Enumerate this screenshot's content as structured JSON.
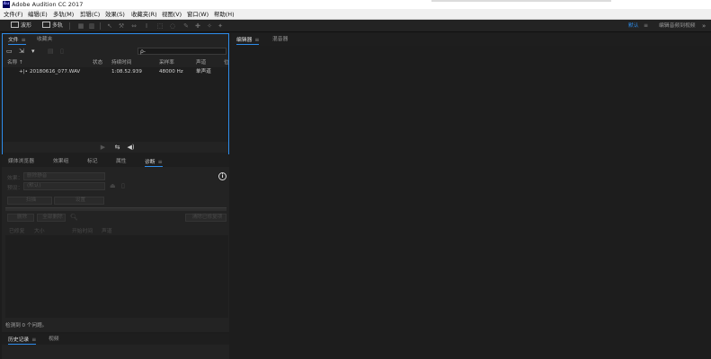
{
  "window": {
    "title": "Adobe Audition CC 2017",
    "logo": "Au"
  },
  "menu": [
    "文件(F)",
    "编辑(E)",
    "多轨(M)",
    "剪辑(C)",
    "效果(S)",
    "收藏夹(R)",
    "视图(V)",
    "窗口(W)",
    "帮助(H)"
  ],
  "toolbar": {
    "waveform_label": "波形",
    "multitrack_label": "多轨",
    "workspace_default": "默认",
    "workspace_edit": "编辑音频到视频",
    "more": "»"
  },
  "files_panel": {
    "tabs": [
      "文件",
      "收藏夹"
    ],
    "search_placeholder": "ρ-",
    "columns": {
      "name": "名称 ↑",
      "status": "状态",
      "duration": "持续时间",
      "sample_rate": "采样率",
      "channels": "声道",
      "bit": "位"
    },
    "rows": [
      {
        "name": "20180616_077.WAV",
        "duration": "1:08.52.939",
        "sample_rate": "48000 Hz",
        "channels": "单声道"
      }
    ]
  },
  "effects_panel": {
    "tabs": [
      "媒体浏览器",
      "效果组",
      "标记",
      "属性",
      "诊断"
    ],
    "effect_label": "效果：",
    "effect_value": "删除静音",
    "preset_label": "预设：",
    "preset_value": "(默认)",
    "scan_button": "扫描",
    "settings_button": "设置",
    "delete_button": "删除",
    "delete_all_button": "全部删除",
    "clear_button": "清除已修复项",
    "result_cols": [
      "已修复",
      "大小",
      "开始时间",
      "声道"
    ],
    "status_text": "检测到 0 个问题。"
  },
  "history_panel": {
    "tabs": [
      "历史记录",
      "视频"
    ]
  },
  "editor_panel": {
    "tabs": [
      "编辑器",
      "混音器"
    ]
  }
}
